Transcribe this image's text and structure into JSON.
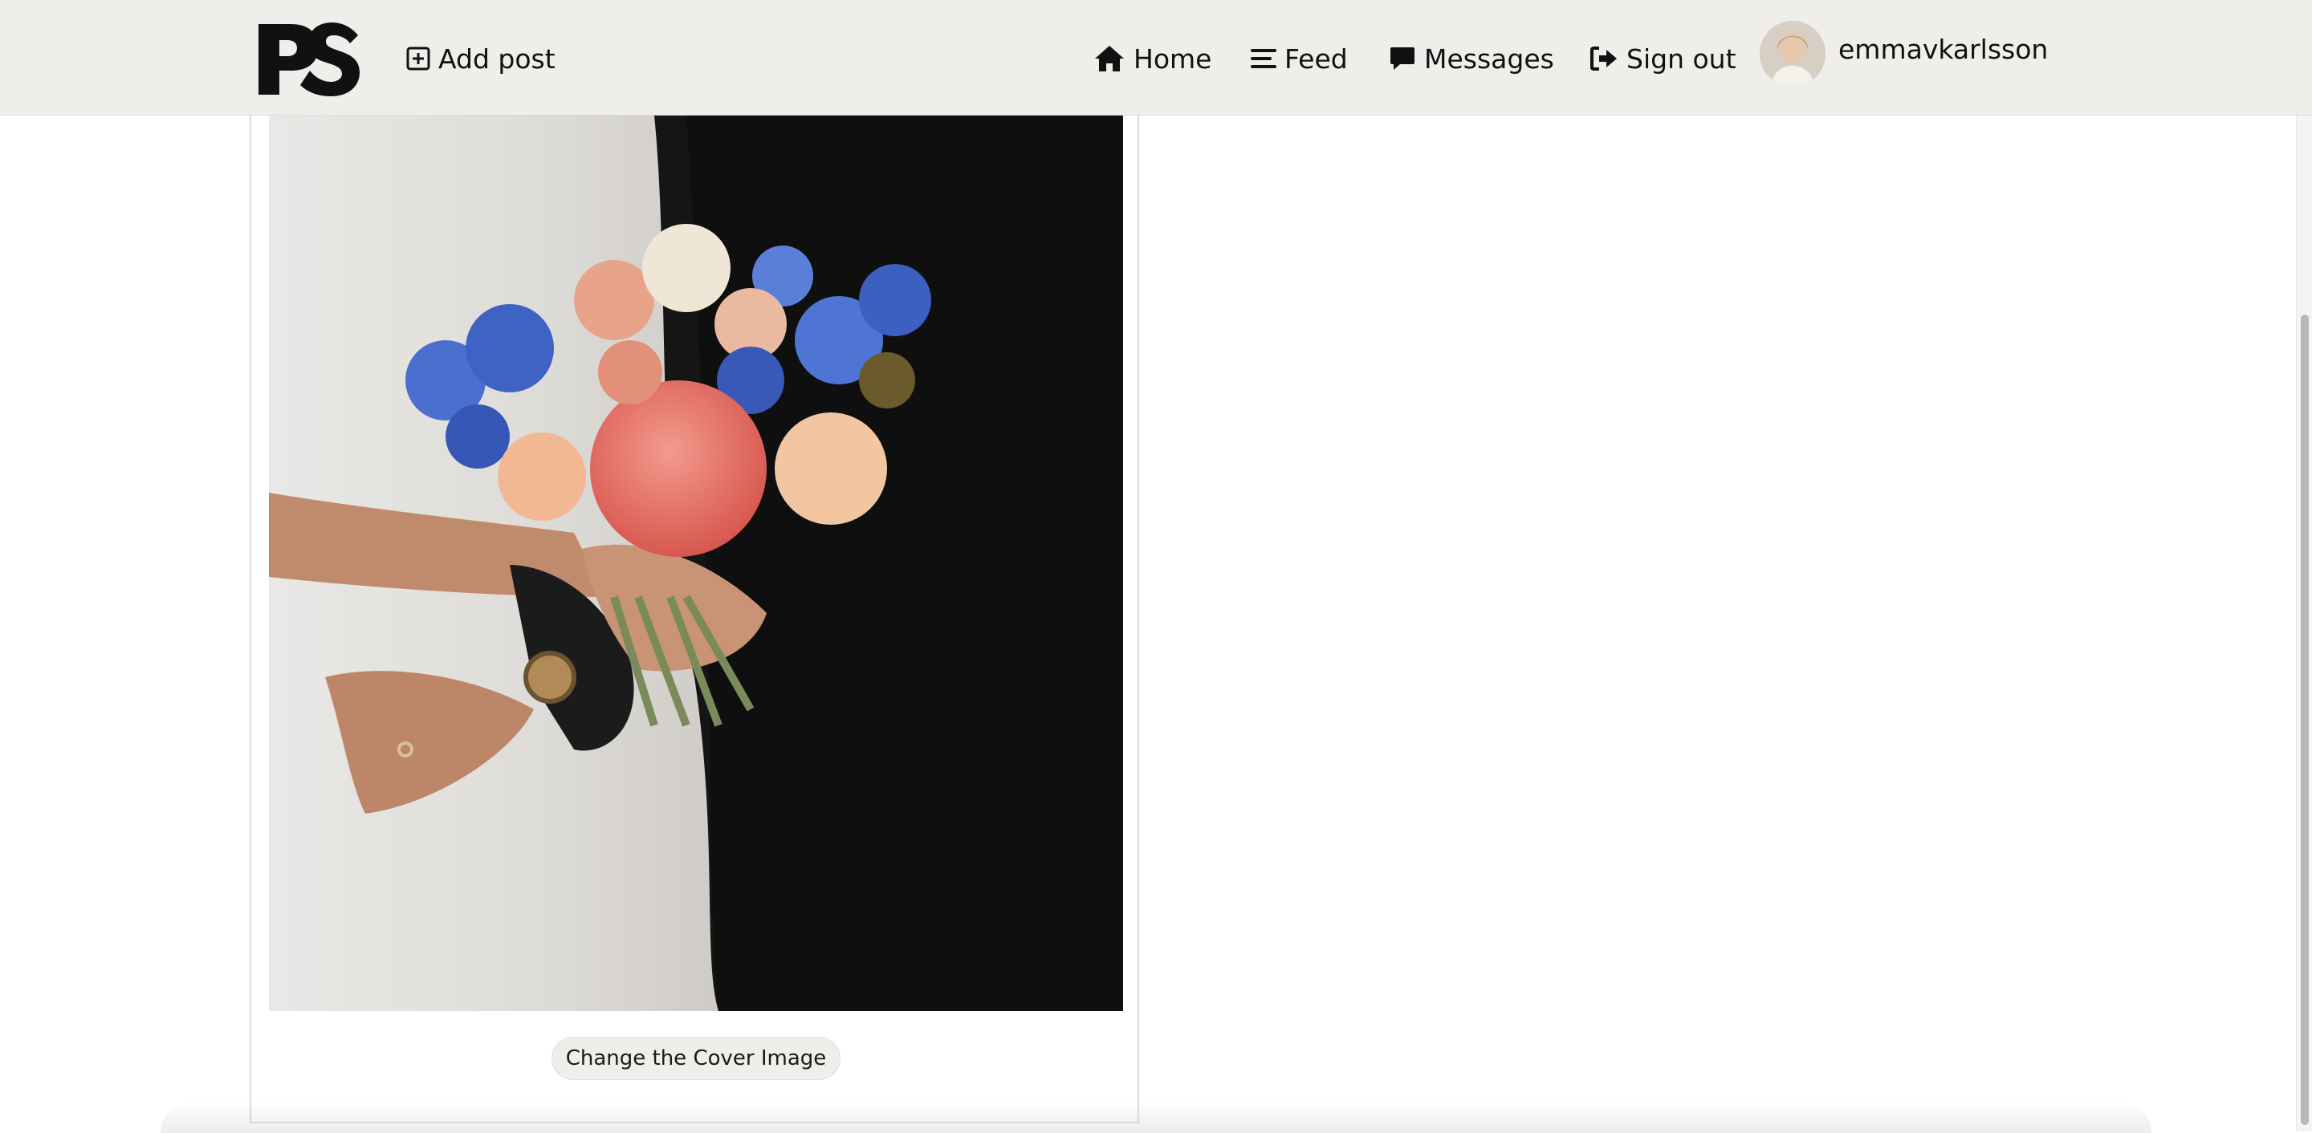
{
  "header": {
    "logo_text": "PS",
    "add_post_label": "Add post",
    "nav": {
      "home": "Home",
      "feed": "Feed",
      "messages": "Messages",
      "sign_out": "Sign out"
    },
    "username": "emmavkarlsson"
  },
  "profile_card": {
    "cover_image_alt": "Wedding bouquet held between bride and groom",
    "change_cover_label": "Change the Cover Image"
  },
  "colors": {
    "navbar_bg": "#efeeeb",
    "button_bg": "#efeeeb",
    "text": "#111111"
  },
  "icons": [
    "add-post-icon",
    "home-icon",
    "feed-icon",
    "messages-icon",
    "sign-out-icon"
  ]
}
